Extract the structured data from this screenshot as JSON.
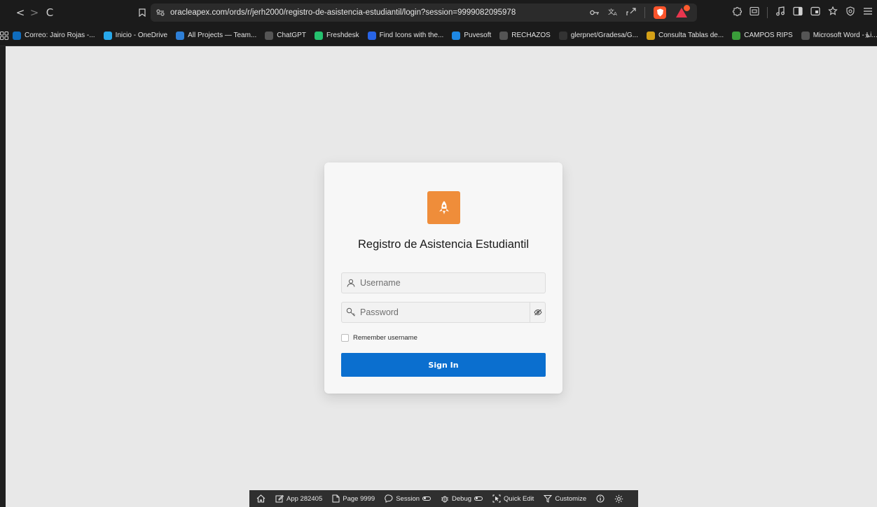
{
  "browser": {
    "url": "oracleapex.com/ords/r/jerh2000/registro-de-asistencia-estudiantil/login?session=9999082095978",
    "nav": {
      "back": "<",
      "forward": ">",
      "reload": "C"
    },
    "icons": [
      "key-icon",
      "translate-icon",
      "share-icon",
      "brave-shield-icon",
      "brave-rewards-icon",
      "extensions-icon",
      "sidebar-icon",
      "music-icon",
      "window-icon",
      "tab-icon",
      "star-icon",
      "vpn-icon",
      "menu-icon"
    ]
  },
  "bookmarks": {
    "items": [
      {
        "label": "Correo: Jairo Rojas -...",
        "color": "#0f6cbd"
      },
      {
        "label": "Inicio - OneDrive",
        "color": "#28a8ea"
      },
      {
        "label": "All Projects — Team...",
        "color": "#2e7fd6"
      },
      {
        "label": "ChatGPT",
        "color": "#555555"
      },
      {
        "label": "Freshdesk",
        "color": "#25c16f"
      },
      {
        "label": "Find Icons with the...",
        "color": "#2864e6"
      },
      {
        "label": "Puvesoft",
        "color": "#1e88e5"
      },
      {
        "label": "RECHAZOS",
        "color": "#555555"
      },
      {
        "label": "glerpnet/Gradesa/G...",
        "color": "#333333"
      },
      {
        "label": "Consulta Tablas de...",
        "color": "#d4a017"
      },
      {
        "label": "CAMPOS RIPS",
        "color": "#3a9d3a"
      },
      {
        "label": "Microsoft Word - Li...",
        "color": "#555555"
      }
    ],
    "more": "»"
  },
  "login": {
    "app_title": "Registro de Asistencia Estudiantil",
    "username_placeholder": "Username",
    "password_placeholder": "Password",
    "remember_label": "Remember username",
    "sign_in_label": "Sign In",
    "logo_color": "#ef8d3a",
    "button_color": "#0b6fcf"
  },
  "devbar": {
    "app": "App 282405",
    "page": "Page 9999",
    "session": "Session",
    "debug": "Debug",
    "quick_edit": "Quick Edit",
    "customize": "Customize"
  }
}
